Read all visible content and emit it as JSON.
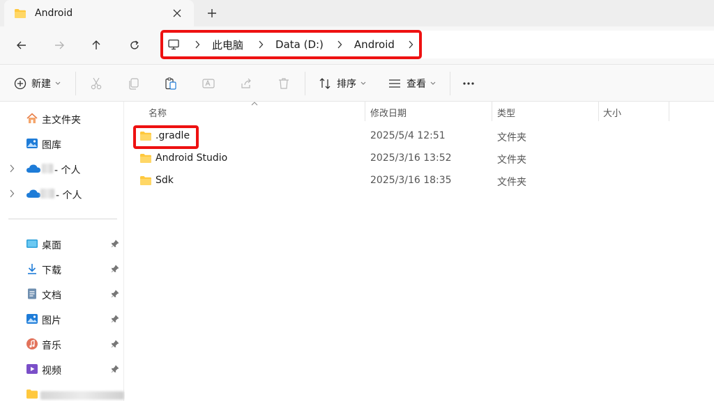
{
  "tab": {
    "title": "Android",
    "icon": "folder-icon"
  },
  "breadcrumb": [
    "此电脑",
    "Data (D:)",
    "Android"
  ],
  "toolbar": {
    "new_label": "新建",
    "sort_label": "排序",
    "view_label": "查看"
  },
  "sidebar": {
    "items": [
      {
        "label": "主文件夹",
        "icon": "home-icon"
      },
      {
        "label": "图库",
        "icon": "gallery-icon"
      },
      {
        "label": "- 个人",
        "icon": "cloud-icon"
      },
      {
        "label": "- 个人",
        "icon": "cloud-icon"
      }
    ],
    "quick_access": [
      {
        "label": "桌面",
        "icon": "desktop-icon"
      },
      {
        "label": "下载",
        "icon": "download-icon"
      },
      {
        "label": "文档",
        "icon": "document-icon"
      },
      {
        "label": "图片",
        "icon": "pictures-icon"
      },
      {
        "label": "音乐",
        "icon": "music-icon"
      },
      {
        "label": "视频",
        "icon": "video-icon"
      }
    ]
  },
  "columns": {
    "name": "名称",
    "modified": "修改日期",
    "type": "类型",
    "size": "大小"
  },
  "files": [
    {
      "name": ".gradle",
      "modified": "2025/5/4 12:51",
      "type": "文件夹"
    },
    {
      "name": "Android Studio",
      "modified": "2025/3/16 13:52",
      "type": "文件夹"
    },
    {
      "name": "Sdk",
      "modified": "2025/3/16 18:35",
      "type": "文件夹"
    }
  ],
  "colors": {
    "highlight": "#ee1111",
    "folder": "#ffc83d",
    "cloud": "#1e7cd8"
  }
}
